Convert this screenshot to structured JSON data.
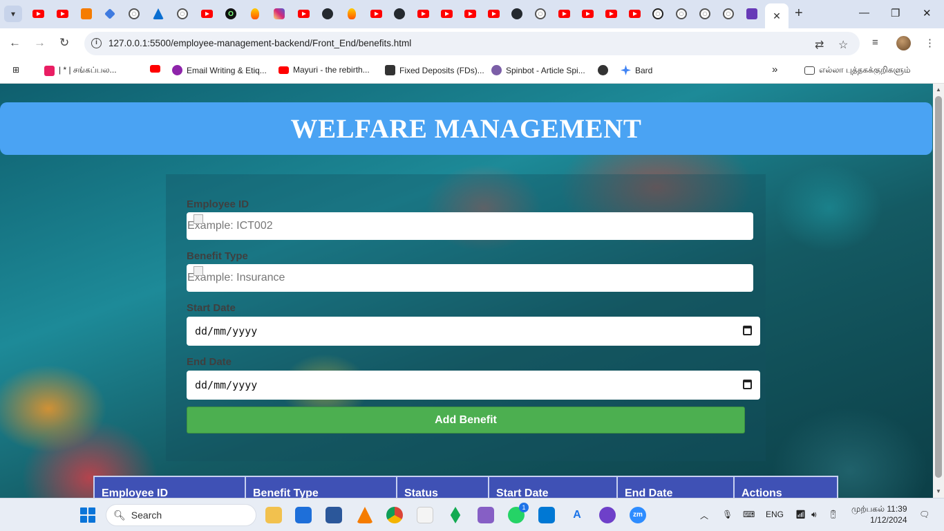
{
  "browser": {
    "tabs_active_close": "✕",
    "new_tab": "+",
    "window_controls": {
      "minimize": "—",
      "restore": "❐",
      "close": "✕"
    },
    "nav": {
      "back": "←",
      "forward": "→",
      "reload": "↻"
    },
    "url": "127.0.0.1:5500/employee-management-backend/Front_End/benefits.html",
    "bookmarks": [
      {
        "label": "| * | சங்கப்பல...",
        "icon": "bookmark-pink-icon",
        "color": "#e91e63"
      },
      {
        "label": "",
        "icon": "youtube-icon",
        "color": "#ff0000"
      },
      {
        "label": "Email Writing & Etiq...",
        "icon": "purple-circle-icon",
        "color": "#8e24aa"
      },
      {
        "label": "Mayuri - the rebirth...",
        "icon": "youtube-icon",
        "color": "#ff0000"
      },
      {
        "label": "Fixed Deposits (FDs)...",
        "icon": "ab-icon",
        "color": "#333333"
      },
      {
        "label": "Spinbot - Article Spi...",
        "icon": "spinbot-icon",
        "color": "#7b5ea7"
      },
      {
        "label": "",
        "icon": "globe-icon",
        "color": "#333333"
      },
      {
        "label": "Bard",
        "icon": "bard-icon",
        "color": "#4285f4"
      }
    ],
    "bookmarks_overflow": "»",
    "all_bookmarks": "எல்லா புத்தகக்குறிகளும்"
  },
  "page": {
    "title": "WELFARE MANAGEMENT",
    "form": {
      "employee_id_label": "Employee ID",
      "employee_id_placeholder": "Example: ICT002",
      "benefit_type_label": "Benefit Type",
      "benefit_type_placeholder": "Example: Insurance",
      "start_date_label": "Start Date",
      "start_date_value": "dd/mm/yyyy",
      "end_date_label": "End Date",
      "end_date_value": "dd/mm/yyyy",
      "submit_label": "Add Benefit"
    },
    "table": {
      "columns": [
        "Employee ID",
        "Benefit Type",
        "Status",
        "Start Date",
        "End Date",
        "Actions"
      ]
    }
  },
  "taskbar": {
    "search_label": "Search",
    "language": "ENG",
    "time": "முற்பகல் 11:39",
    "date": "1/12/2024",
    "whatsapp_badge": "1"
  },
  "colors": {
    "header_bar": "#4aa3f3",
    "add_button": "#4caf50",
    "table_header": "#3f51b5"
  }
}
